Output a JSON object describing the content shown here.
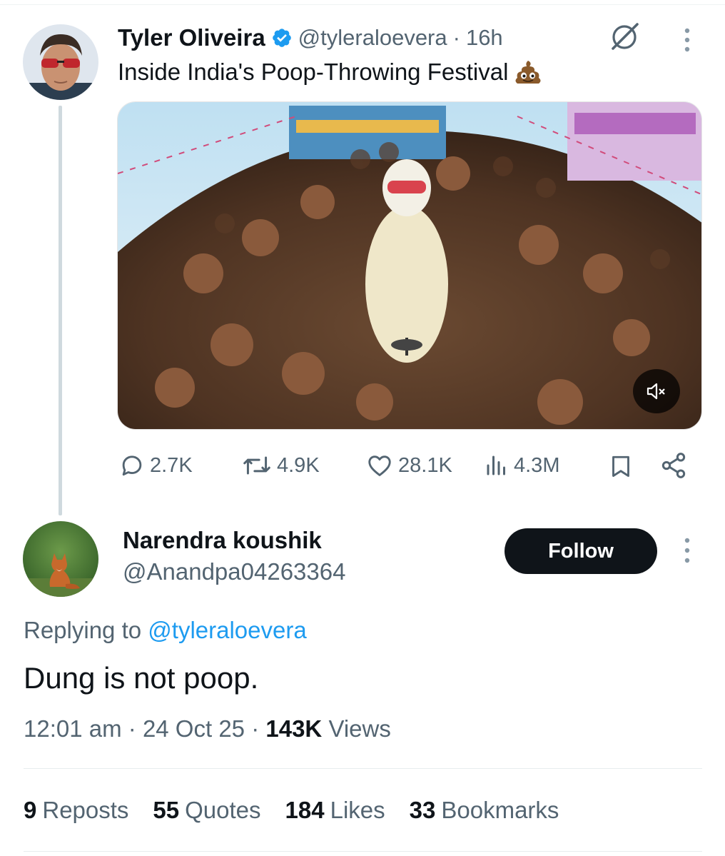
{
  "parent_tweet": {
    "author_name": "Tyler Oliveira",
    "handle": "@tyleraloevera",
    "separator": "·",
    "time_ago": "16h",
    "text": "Inside India's Poop-Throwing Festival",
    "emoji_icon": "poop-emoji",
    "actions": {
      "replies": "2.7K",
      "reposts": "4.9K",
      "likes": "28.1K",
      "views": "4.3M"
    }
  },
  "reply": {
    "author_name": "Narendra koushik",
    "handle": "@Anandpa04263364",
    "follow_label": "Follow",
    "replying_prefix": "Replying to",
    "replying_handle": "@tyleraloevera",
    "text": "Dung is not poop.",
    "time": "12:01 am",
    "date": "24 Oct 25",
    "views_count": "143K",
    "views_label": "Views",
    "separator": "·"
  },
  "stats": {
    "reposts_count": "9",
    "reposts_label": "Reposts",
    "quotes_count": "55",
    "quotes_label": "Quotes",
    "likes_count": "184",
    "likes_label": "Likes",
    "bookmarks_count": "33",
    "bookmarks_label": "Bookmarks"
  },
  "colors": {
    "link_blue": "#1d9bf0",
    "text_primary": "#0f1419",
    "text_secondary": "#536471",
    "follow_bg": "#0f1419"
  }
}
